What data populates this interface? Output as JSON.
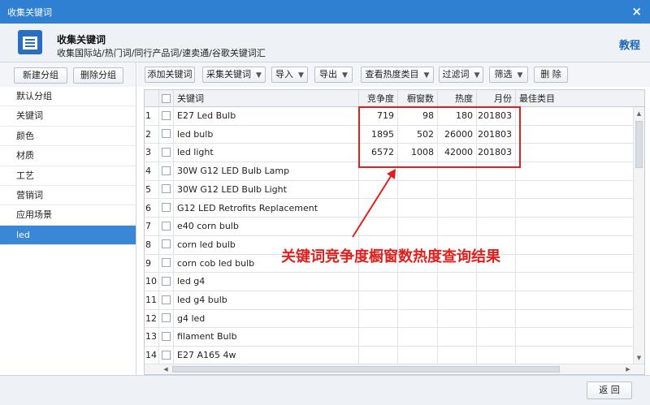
{
  "window": {
    "title": "收集关键词",
    "close_glyph": "×"
  },
  "header": {
    "title": "收集关键词",
    "subtitle": "收集国际站/热门词/同行产品词/速卖通/谷歌关键词汇",
    "help": "教程"
  },
  "left_buttons": {
    "new_group": "新建分组",
    "delete_group": "删除分组"
  },
  "sidebar": {
    "items": [
      "默认分组",
      "关键词",
      "颜色",
      "材质",
      "工艺",
      "营销词",
      "应用场景",
      "led"
    ],
    "active_index": 7
  },
  "toolbar": {
    "add_keyword": "添加关键词",
    "collect_keyword": "采集关键词",
    "import": "导入",
    "export": "导出",
    "check_category": "查看热度类目",
    "filter_words": "过滤词",
    "screen": "筛选",
    "delete": "删 除"
  },
  "table": {
    "columns": {
      "keyword": "关键词",
      "competition": "竞争度",
      "showcase": "橱窗数",
      "heat": "热度",
      "month": "月份",
      "best_category": "最佳类目"
    },
    "rows": [
      {
        "no": "1",
        "keyword": "E27 Led Bulb",
        "competition": "719",
        "showcase": "98",
        "heat": "180",
        "month": "201803"
      },
      {
        "no": "2",
        "keyword": "led bulb",
        "competition": "1895",
        "showcase": "502",
        "heat": "26000",
        "month": "201803"
      },
      {
        "no": "3",
        "keyword": "led light",
        "competition": "6572",
        "showcase": "1008",
        "heat": "42000",
        "month": "201803"
      },
      {
        "no": "4",
        "keyword": "30W G12 LED Bulb Lamp",
        "competition": "",
        "showcase": "",
        "heat": "",
        "month": ""
      },
      {
        "no": "5",
        "keyword": "30W G12 LED Bulb Light",
        "competition": "",
        "showcase": "",
        "heat": "",
        "month": ""
      },
      {
        "no": "6",
        "keyword": "G12 LED Retrofits Replacement",
        "competition": "",
        "showcase": "",
        "heat": "",
        "month": ""
      },
      {
        "no": "7",
        "keyword": "e40 corn bulb",
        "competition": "",
        "showcase": "",
        "heat": "",
        "month": ""
      },
      {
        "no": "8",
        "keyword": "corn led bulb",
        "competition": "",
        "showcase": "",
        "heat": "",
        "month": ""
      },
      {
        "no": "9",
        "keyword": "corn cob led bulb",
        "competition": "",
        "showcase": "",
        "heat": "",
        "month": ""
      },
      {
        "no": "10",
        "keyword": "led g4",
        "competition": "",
        "showcase": "",
        "heat": "",
        "month": ""
      },
      {
        "no": "11",
        "keyword": "led g4 bulb",
        "competition": "",
        "showcase": "",
        "heat": "",
        "month": ""
      },
      {
        "no": "12",
        "keyword": "g4 led",
        "competition": "",
        "showcase": "",
        "heat": "",
        "month": ""
      },
      {
        "no": "13",
        "keyword": "filament  Bulb",
        "competition": "",
        "showcase": "",
        "heat": "",
        "month": ""
      },
      {
        "no": "14",
        "keyword": "E27 A165 4w",
        "competition": "",
        "showcase": "",
        "heat": "",
        "month": ""
      }
    ]
  },
  "annotation": {
    "text": "关键词竞争度橱窗数热度查询结果",
    "color": "#e0201e"
  },
  "footer": {
    "back": "返 回"
  },
  "colors": {
    "title_bar": "#2f7fd3",
    "selected_item": "#3a86d7",
    "help_link": "#1a64b8"
  }
}
